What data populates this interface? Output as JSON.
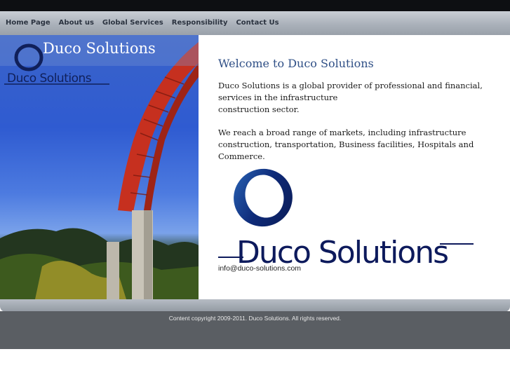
{
  "nav": {
    "items": [
      {
        "label": "Home Page"
      },
      {
        "label": "About us"
      },
      {
        "label": "Global Services"
      },
      {
        "label": "Responsibility"
      },
      {
        "label": "Contact Us"
      }
    ]
  },
  "hero": {
    "title": "Duco Solutions",
    "logo_text": "Duco Solutions"
  },
  "main": {
    "heading": "Welcome to Duco Solutions",
    "paragraph1_line1": "Duco Solutions is a global provider of professional and financial, services in the infrastructure",
    "paragraph1_line2": "construction sector.",
    "paragraph2_line1": "We reach a broad range of markets, including infrastructure construction, transportation, Business facilities, Hospitals and",
    "paragraph2_line2": "Commerce.",
    "logo_text": "Duco Solutions",
    "email": "info@duco-solutions.com"
  },
  "footer": {
    "copyright": "Content copyright 2009-2011. Duco Solutions. All rights reserved."
  },
  "colors": {
    "nav_text": "#2b3340",
    "heading": "#2f4f86",
    "logo_dark": "#0d1a5c",
    "logo_ring": "#1f4fa0",
    "footer_bg": "#5a5e63"
  }
}
